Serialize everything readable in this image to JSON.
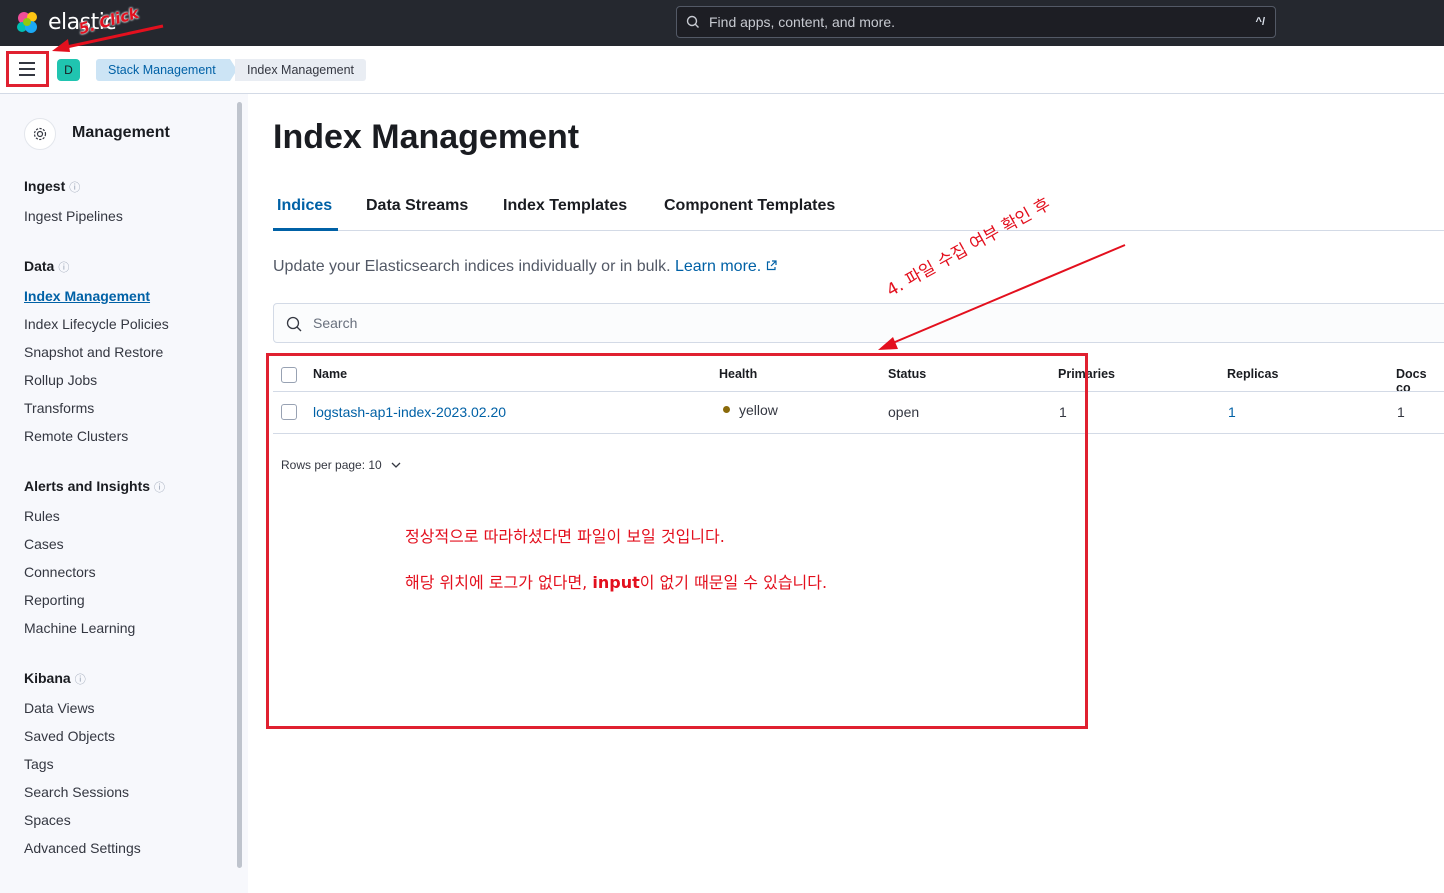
{
  "header": {
    "logo_text": "elastic",
    "search_placeholder": "Find apps, content, and more.",
    "search_shortcut": "^/"
  },
  "subbar": {
    "space_initial": "D",
    "breadcrumbs": [
      "Stack Management",
      "Index Management"
    ]
  },
  "sidebar": {
    "title": "Management",
    "groups": [
      {
        "label": "Ingest",
        "items": [
          "Ingest Pipelines"
        ]
      },
      {
        "label": "Data",
        "items": [
          "Index Management",
          "Index Lifecycle Policies",
          "Snapshot and Restore",
          "Rollup Jobs",
          "Transforms",
          "Remote Clusters"
        ]
      },
      {
        "label": "Alerts and Insights",
        "items": [
          "Rules",
          "Cases",
          "Connectors",
          "Reporting",
          "Machine Learning"
        ]
      },
      {
        "label": "Kibana",
        "items": [
          "Data Views",
          "Saved Objects",
          "Tags",
          "Search Sessions",
          "Spaces",
          "Advanced Settings"
        ]
      }
    ],
    "active_item": "Index Management"
  },
  "main": {
    "title": "Index Management",
    "tabs": [
      "Indices",
      "Data Streams",
      "Index Templates",
      "Component Templates"
    ],
    "active_tab": "Indices",
    "description": "Update your Elasticsearch indices individually or in bulk.",
    "learn_more": "Learn more.",
    "search_placeholder": "Search",
    "table": {
      "columns": [
        "Name",
        "Health",
        "Status",
        "Primaries",
        "Replicas",
        "Docs co"
      ],
      "rows": [
        {
          "name": "logstash-ap1-index-2023.02.20",
          "health": "yellow",
          "status": "open",
          "primaries": "1",
          "replicas": "1",
          "docs": "1"
        }
      ]
    },
    "rows_per_page": "Rows per page: 10"
  },
  "annotations": {
    "step5": "5. Click",
    "step4": "4. 파일 수집 여부  확인 후",
    "note_line1": "정상적으로 따라하셨다면 파일이 보일 것입니다.",
    "note_line2_pre": "해당 위치에 로그가 없다면, ",
    "note_line2_bold": "input",
    "note_line2_post": "이 없기 때문일 수 있습니다.",
    "color": "#e3101e"
  }
}
